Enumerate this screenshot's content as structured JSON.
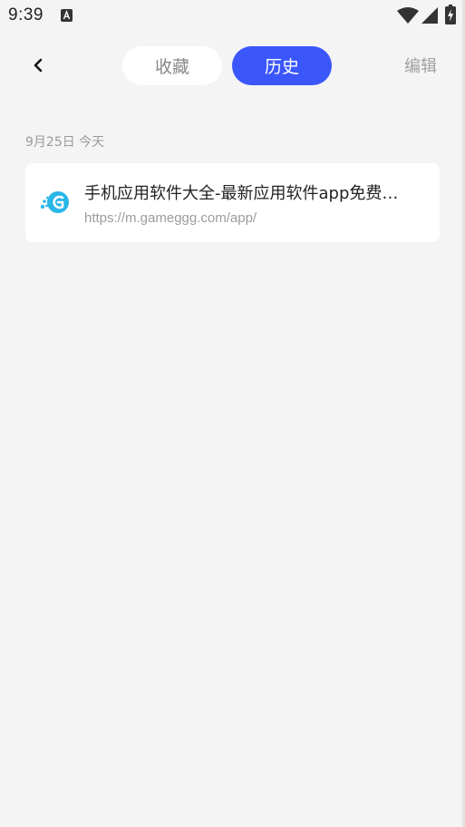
{
  "status_bar": {
    "time": "9:39",
    "icons": [
      "notification-a-icon",
      "wifi-icon",
      "signal-icon",
      "battery-charging-icon"
    ]
  },
  "nav": {
    "back_icon": "chevron-left-icon",
    "tabs": [
      {
        "label": "收藏",
        "active": false
      },
      {
        "label": "历史",
        "active": true
      }
    ],
    "edit_label": "编辑"
  },
  "history": {
    "date_header": "9月25日 今天",
    "items": [
      {
        "title": "手机应用软件大全-最新应用软件app免费…",
        "url": "https://m.gameggg.com/app/",
        "icon": "gameggg-logo-icon"
      }
    ]
  },
  "colors": {
    "accent": "#3b57fc",
    "background": "#f4f4f4",
    "card": "#ffffff",
    "logo": "#29b6e8"
  }
}
